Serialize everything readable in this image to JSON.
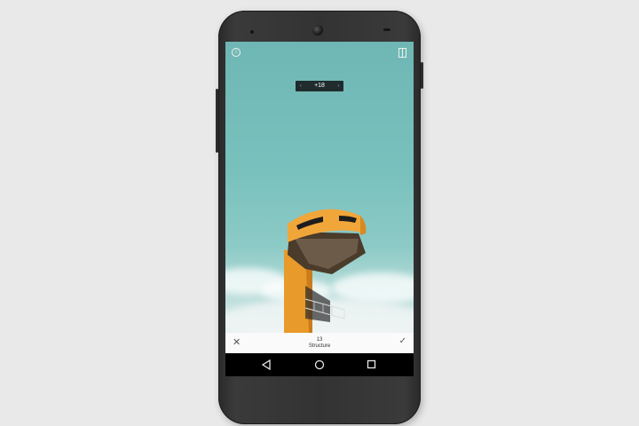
{
  "device": {
    "model": "android-phone"
  },
  "editor": {
    "adjust_value": "+18",
    "tool": {
      "value": "13",
      "name": "Structure"
    },
    "icons": {
      "info": "info-icon",
      "compare": "compare-icon",
      "decrease": "chevron-left-icon",
      "increase": "chevron-right-icon",
      "cancel": "close-icon",
      "apply": "check-icon"
    }
  },
  "navigation": {
    "back": "back-icon",
    "home": "home-icon",
    "recents": "recents-icon"
  },
  "colors": {
    "sky": "#79c1bd",
    "tower": "#f1a63a",
    "phone_body": "#333333",
    "background": "#e9e9e9"
  }
}
